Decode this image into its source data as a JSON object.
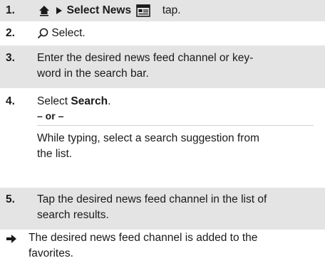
{
  "steps": [
    {
      "number": "1.",
      "part_select": "Select News",
      "part_tap": "tap.",
      "icons": [
        "home-icon",
        "triangle-right-icon",
        "news-icon"
      ]
    },
    {
      "number": "2.",
      "text": "Select.",
      "icons": [
        "search-icon"
      ]
    },
    {
      "number": "3.",
      "line1": "Enter the desired news feed channel or key-",
      "line2": "word in the search bar."
    },
    {
      "number": "4.",
      "text_pre": "Select ",
      "text_bold": "Search",
      "text_post": ".",
      "or_label": "– or –",
      "alt_line1": "While typing, select a search suggestion from",
      "alt_line2": "the list."
    },
    {
      "number": "5.",
      "line1": "Tap the desired news feed channel in the list of",
      "line2": "search results."
    }
  ],
  "result": {
    "line1": "The desired news feed channel is added to the",
    "line2": "favorites.",
    "icon": "arrow-right-icon"
  }
}
